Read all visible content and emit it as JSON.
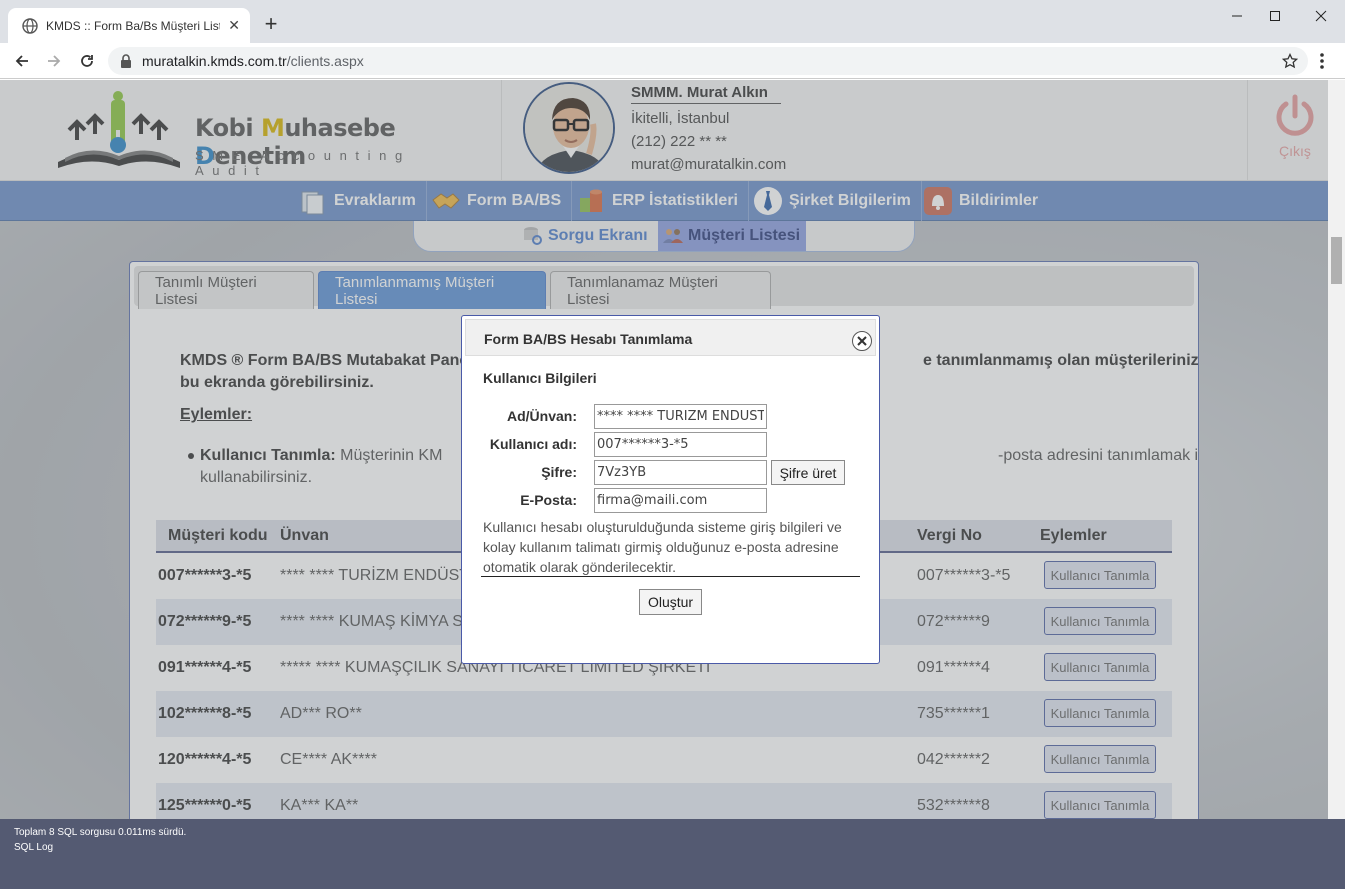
{
  "browser": {
    "tab_title": "KMDS :: Form Ba/Bs Müşteri Listesi",
    "url_host": "muratalkin.kmds.com.tr",
    "url_path": "/clients.aspx"
  },
  "brand": {
    "word1_first": "Kobi",
    "word2_first": "M",
    "word2_rest": "uhasebe",
    "word3_first": "D",
    "word3_rest": "enetim",
    "subtitle": "SME Accounting Audit"
  },
  "profile": {
    "name": "SMMM. Murat Alkın",
    "address": "İkitelli, İstanbul",
    "phone": "(212) 222 ** **",
    "email": "murat@muratalkin.com"
  },
  "logout_label": "Çıkış",
  "nav": [
    {
      "label": "Evraklarım"
    },
    {
      "label": "Form BA/BS"
    },
    {
      "label": "ERP İstatistikleri"
    },
    {
      "label": "Şirket Bilgilerim"
    },
    {
      "label": "Bildirimler"
    }
  ],
  "subnav": [
    {
      "label": "Sorgu Ekranı"
    },
    {
      "label": "Müşteri Listesi"
    }
  ],
  "panel_tabs": [
    {
      "label": "Tanımlı Müşteri Listesi"
    },
    {
      "label": "Tanımlanmamış Müşteri Listesi"
    },
    {
      "label": "Tanımlanamaz Müşteri Listesi"
    }
  ],
  "intro_line1": "KMDS ® Form BA/BS Mutabakat Pane",
  "intro_line1_tail": "e tanımlanmamış olan müşterilerinizi",
  "intro_line2": "bu ekranda görebilirsiniz.",
  "actions_heading": "Eylemler:",
  "bullet": {
    "title": "Kullanıcı Tanımla:",
    "text": " Müşterinin KM",
    "tail": "-posta adresini tanımlamak için",
    "line2": "kullanabilirsiniz."
  },
  "table": {
    "headers": [
      "Müşteri kodu",
      "Ünvan",
      "Vergi No",
      "Eylemler"
    ],
    "action_label": "Kullanıcı Tanımla",
    "rows": [
      {
        "code": "007******3-*5",
        "title": "**** **** TURİZM ENDÜST",
        "tax": "007******3-*5"
      },
      {
        "code": "072******9-*5",
        "title": "**** **** KUMAŞ KİMYA S",
        "tax": "072******9"
      },
      {
        "code": "091******4-*5",
        "title": "***** **** KUMAŞÇILIK SANAYİ TİCARET LİMİTED ŞİRKETİ",
        "tax": "091******4"
      },
      {
        "code": "102******8-*5",
        "title": "AD*** RO**",
        "tax": "735******1"
      },
      {
        "code": "120******4-*5",
        "title": "CE**** AK****",
        "tax": "042******2"
      },
      {
        "code": "125******0-*5",
        "title": "KA*** KA**",
        "tax": "532******8"
      }
    ]
  },
  "modal": {
    "title": "Form BA/BS Hesabı Tanımlama",
    "section": "Kullanıcı Bilgileri",
    "fields": {
      "name_label": "Ad/Ünvan:",
      "name_value": "**** **** TURİZM ENDÜSTRİ",
      "user_label": "Kullanıcı adı:",
      "user_value": "007******3-*5",
      "pass_label": "Şifre:",
      "pass_value": "7Vz3YB",
      "mail_label": "E-Posta:",
      "mail_value": "firma@maili.com"
    },
    "generate_label": "Şifre üret",
    "note": "Kullanıcı hesabı oluşturulduğunda sisteme giriş bilgileri ve kolay kullanım talimatı girmiş olduğunuz e-posta adresine otomatik olarak gönderilecektir.",
    "submit_label": "Oluştur"
  },
  "footer": {
    "line1": "Toplam 8 SQL sorgusu 0.011ms sürdü.",
    "line2": "SQL Log"
  }
}
